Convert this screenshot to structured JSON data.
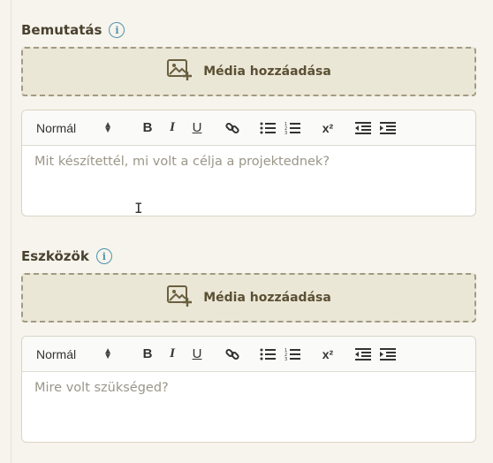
{
  "sections": [
    {
      "title": "Bemutatás",
      "media_label": "Média hozzáadása",
      "format_select": "Normál",
      "placeholder": "Mit készítettél, mi volt a célja a projektednek?"
    },
    {
      "title": "Eszközök",
      "media_label": "Média hozzáadása",
      "format_select": "Normál",
      "placeholder": "Mire volt szükséged?"
    }
  ],
  "toolbar": {
    "bold": "B",
    "italic": "I",
    "underline": "U",
    "superscript": "x²"
  },
  "info_glyph": "i",
  "colors": {
    "accent": "#4f93ad",
    "drop_bg": "#ebe7d7",
    "drop_border": "#a29a82",
    "title": "#4a4130"
  }
}
